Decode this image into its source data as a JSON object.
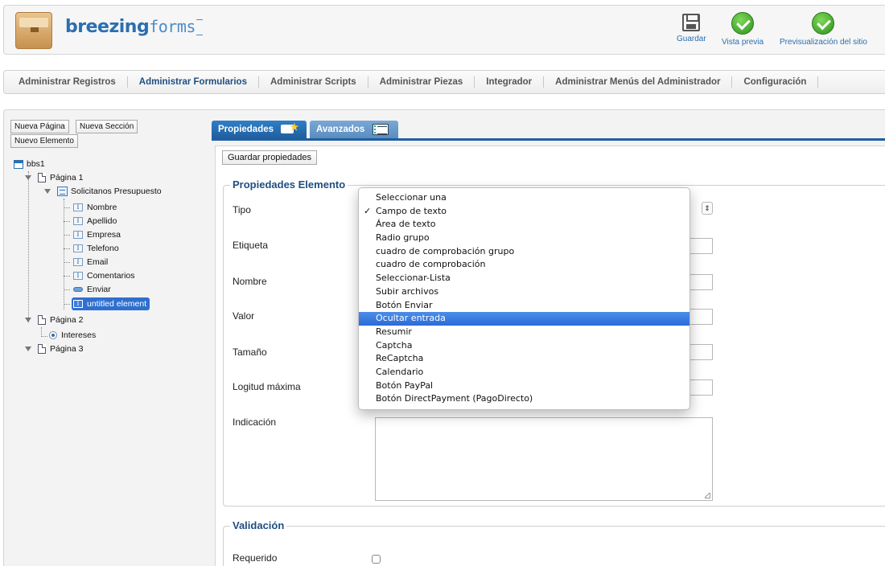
{
  "header": {
    "logo_bold": "breezing",
    "logo_thin": "forms",
    "toolbar": {
      "save": "Guardar",
      "preview": "Vista previa",
      "site_preview": "Previsualización del sitio"
    }
  },
  "nav": {
    "items": [
      "Administrar Registros",
      "Administrar Formularios",
      "Administrar Scripts",
      "Administrar Piezas",
      "Integrador",
      "Administrar Menús del Administrador",
      "Configuración"
    ],
    "active_index": 1
  },
  "left": {
    "buttons": {
      "new_page": "Nueva Página",
      "new_section": "Nueva Sección",
      "new_element": "Nuevo Elemento"
    },
    "tree": {
      "root": "bbs1",
      "page1": "Página 1",
      "section": "Solicitanos Presupuesto",
      "fields": [
        "Nombre",
        "Apellido",
        "Empresa",
        "Telefono",
        "Email",
        "Comentarios",
        "Enviar",
        "untitled element"
      ],
      "page2": "Página 2",
      "page2_field": "Intereses",
      "page3": "Página 3"
    }
  },
  "tabs": {
    "properties": "Propiedades",
    "advanced": "Avanzados"
  },
  "form": {
    "save_button": "Guardar propiedades",
    "legend_properties": "Propiedades Elemento",
    "labels": {
      "tipo": "Tipo",
      "etiqueta": "Etiqueta",
      "nombre": "Nombre",
      "valor": "Valor",
      "tamano": "Tamaño",
      "logitud": "Logitud máxima",
      "indicacion": "Indicación"
    },
    "legend_validation": "Validación",
    "required_label": "Requerido"
  },
  "dropdown": {
    "options": [
      "Seleccionar una",
      "Campo de texto",
      "Área de texto",
      "Radio grupo",
      "cuadro de comprobación grupo",
      "cuadro de comprobación",
      "Seleccionar-Lista",
      "Subir archivos",
      "Botón Enviar",
      "Ocultar entrada",
      "Resumir",
      "Captcha",
      "ReCaptcha",
      "Calendario",
      "Botón PayPal",
      "Botón DirectPayment (PagoDirecto)"
    ],
    "checked_mark": "✓",
    "checked_index": 1,
    "highlighted_index": 9
  }
}
